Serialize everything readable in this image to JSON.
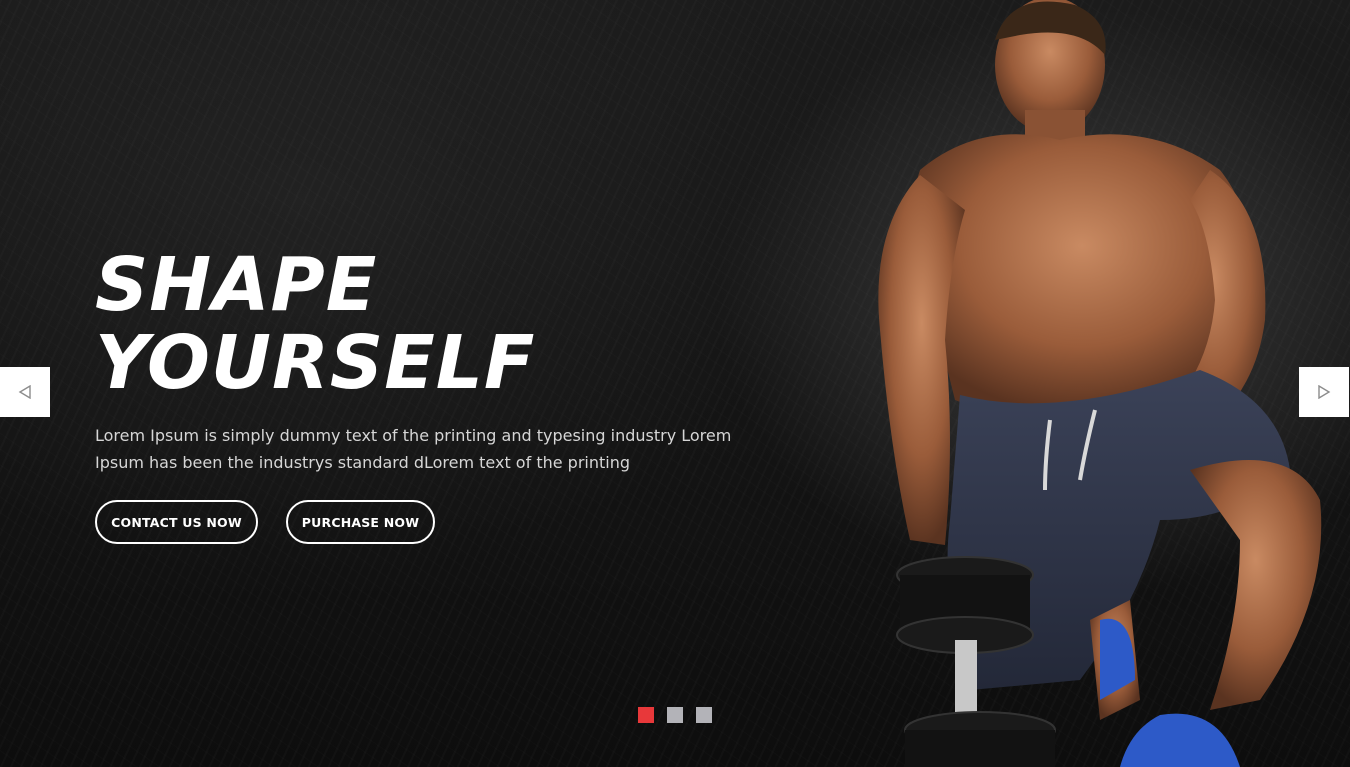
{
  "hero": {
    "title_line1": "SHAPE",
    "title_line2": "YOURSELF",
    "description": "Lorem Ipsum is simply dummy text of the printing and typesing industry Lorem Ipsum has been the industrys standard dLorem text of the printing",
    "buttons": {
      "contact_label": "CONTACT US NOW",
      "purchase_label": "PURCHASE NOW"
    }
  },
  "slider": {
    "prev_icon": "triangle-left-icon",
    "next_icon": "triangle-right-icon",
    "active_index": 0,
    "slide_count": 3
  },
  "colors": {
    "dot_active": "#e8383a",
    "dot_inactive": "#b3b3b8",
    "arrow_bg": "#ffffff",
    "arrow_icon": "#8c8c8c",
    "text": "#ffffff"
  }
}
